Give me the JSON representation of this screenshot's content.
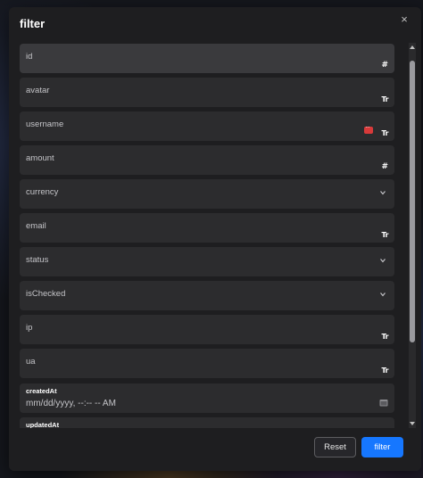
{
  "modal": {
    "title": "filter",
    "close_glyph": "×"
  },
  "fields": [
    {
      "label": "id",
      "type_icon": "#"
    },
    {
      "label": "avatar",
      "type_icon": "Tr"
    },
    {
      "label": "username",
      "type_icon": "Tr"
    },
    {
      "label": "amount",
      "type_icon": "#"
    },
    {
      "label": "currency"
    },
    {
      "label": "email",
      "type_icon": "Tr"
    },
    {
      "label": "status"
    },
    {
      "label": "isChecked"
    },
    {
      "label": "ip",
      "type_icon": "Tr"
    },
    {
      "label": "ua",
      "type_icon": "Tr"
    }
  ],
  "created_at": {
    "label": "createdAt",
    "value": "mm/dd/yyyy, --:-- -- AM"
  },
  "updated_at": {
    "label": "updatedAt"
  },
  "footer": {
    "reset_label": "Reset",
    "filter_label": "filter"
  },
  "colors": {
    "primary": "#1677ff",
    "field_bg": "#2c2c2e",
    "modal_bg": "#1e1e20"
  }
}
